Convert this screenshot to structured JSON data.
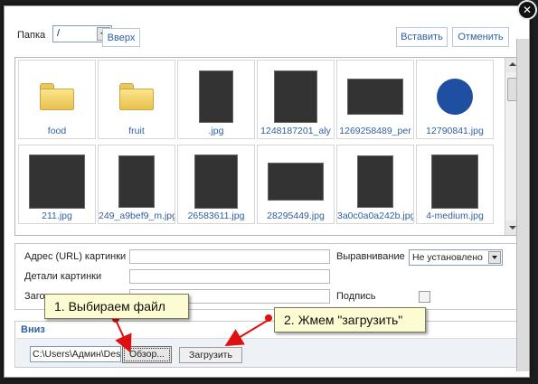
{
  "toolbar": {
    "folder_label": "Папка",
    "folder_value": "/",
    "up_label": "Вверх",
    "insert_label": "Вставить",
    "cancel_label": "Отменить"
  },
  "files": [
    {
      "name": "food",
      "kind": "folder"
    },
    {
      "name": "fruit",
      "kind": "folder"
    },
    {
      "name": ".jpg",
      "kind": "image"
    },
    {
      "name": "1248187201_aly",
      "kind": "image"
    },
    {
      "name": "1269258489_per",
      "kind": "image"
    },
    {
      "name": "12790841.jpg",
      "kind": "image"
    },
    {
      "name": "211.jpg",
      "kind": "image"
    },
    {
      "name": "249_a9bef9_m.jpg",
      "kind": "image"
    },
    {
      "name": "26583611.jpg",
      "kind": "image"
    },
    {
      "name": "28295449.jpg",
      "kind": "image"
    },
    {
      "name": "3a0c0a0a242b.jpg",
      "kind": "image"
    },
    {
      "name": "4-medium.jpg",
      "kind": "image"
    }
  ],
  "props": {
    "url_label": "Адрес (URL) картинки",
    "url_value": "",
    "details_label": "Детали картинки",
    "details_value": "",
    "title_label": "Заголовок картинки",
    "title_value": "",
    "align_label": "Выравнивание",
    "align_value": "Не установлено",
    "caption_label": "Подпись"
  },
  "upload": {
    "legend": "Вниз",
    "file_path": "C:\\Users\\Админ\\Des",
    "browse_label": "Обзор...",
    "upload_label": "Загрузить"
  },
  "annotations": {
    "step1": "1. Выбираем файл",
    "step2": "2. Жмем \"загрузить\"",
    "color": "#e01010"
  },
  "icons": {
    "close": "close-icon",
    "folder": "folder-icon",
    "dropdown": "chevron-down-icon"
  }
}
